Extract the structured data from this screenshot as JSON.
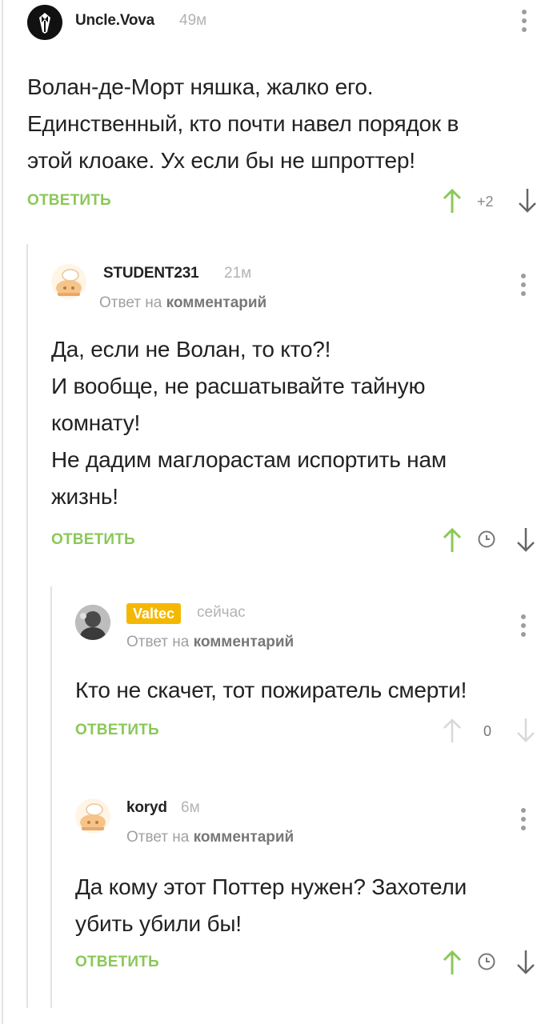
{
  "comments": [
    {
      "author": "Uncle.Vova",
      "time": "49м",
      "body": "Волан-де-Морт няшка, жалко его.\nЕдинственный, кто почти навел порядок в\nэтой клоаке. Ух если бы не шпроттер!",
      "reply_label": "ОТВЕТИТЬ",
      "score": "+2",
      "avatar_icon": "tuxedo-avatar-icon"
    },
    {
      "author": "STUDENT231",
      "time": "21м",
      "reply_to_prefix": "Ответ на",
      "reply_to_link": "комментарий",
      "body": "Да, если не Волан, то кто?!\nИ вообще, не расшатывайте тайную\nкомнату!\nНе дадим маглорастам испортить нам\nжизнь!",
      "reply_label": "ОТВЕТИТЬ",
      "avatar_icon": "chef-avatar-icon"
    },
    {
      "author": "Valtec",
      "time": "сейчас",
      "reply_to_prefix": "Ответ на",
      "reply_to_link": "комментарий",
      "body": "Кто не скачет, тот пожиратель смерти!",
      "reply_label": "ОТВЕТИТЬ",
      "score": "0",
      "avatar_icon": "user-photo-avatar-icon",
      "badge_color": "#f5b800"
    },
    {
      "author": "koryd",
      "time": "6м",
      "reply_to_prefix": "Ответ на",
      "reply_to_link": "комментарий",
      "body": "Да кому этот Поттер нужен? Захотели\nубить убили бы!",
      "reply_label": "ОТВЕТИТЬ",
      "avatar_icon": "chef-avatar-icon"
    }
  ],
  "colors": {
    "accent_green": "#8ac858",
    "muted_gray": "#b3b3b3",
    "thread_line": "#e3e3e3"
  }
}
